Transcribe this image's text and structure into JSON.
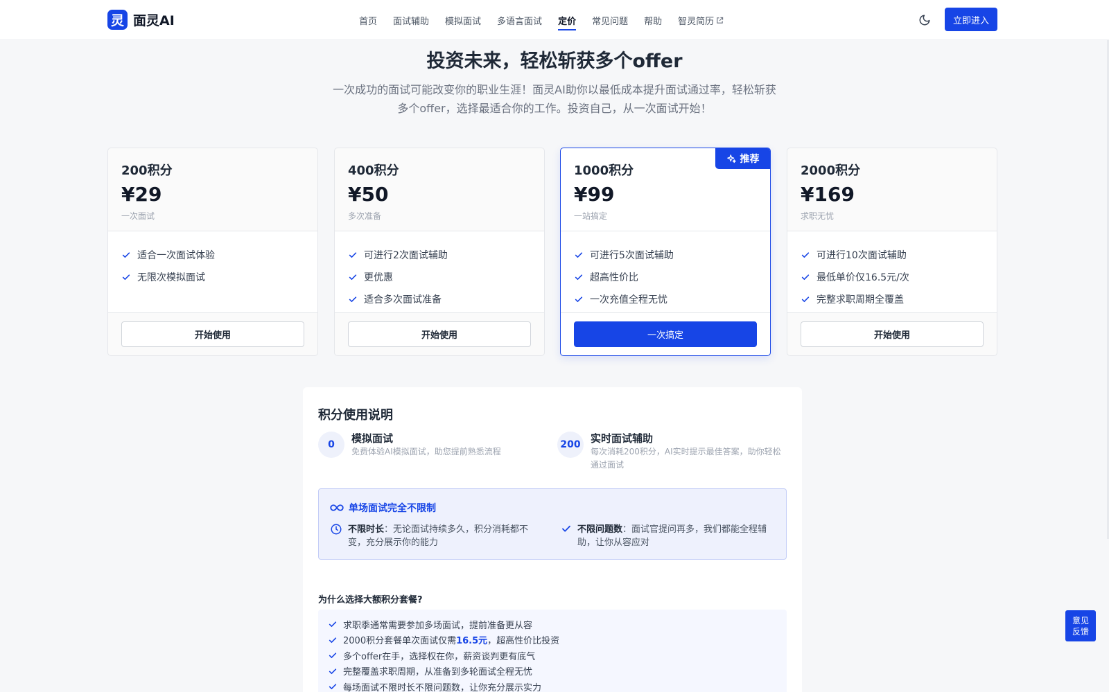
{
  "header": {
    "logo_mark": "灵",
    "logo_text": "面灵AI",
    "nav": [
      {
        "label": "首页"
      },
      {
        "label": "面试辅助"
      },
      {
        "label": "模拟面试"
      },
      {
        "label": "多语言面试"
      },
      {
        "label": "定价",
        "active": true
      },
      {
        "label": "常见问题"
      },
      {
        "label": "帮助"
      },
      {
        "label": "智灵简历",
        "external": true
      }
    ],
    "enter_label": "立即进入"
  },
  "hero": {
    "title": "投资未来，轻松斩获多个offer",
    "subtitle": "一次成功的面试可能改变你的职业生涯！面灵AI助你以最低成本提升面试通过率，轻松斩获多个offer，选择最适合你的工作。投资自己，从一次面试开始！"
  },
  "plans": [
    {
      "name": "200积分",
      "price": "¥29",
      "tag": "一次面试",
      "features": [
        "适合一次面试体验",
        "无限次模拟面试"
      ],
      "button": "开始使用"
    },
    {
      "name": "400积分",
      "price": "¥50",
      "tag": "多次准备",
      "features": [
        "可进行2次面试辅助",
        "更优惠",
        "适合多次面试准备"
      ],
      "button": "开始使用"
    },
    {
      "name": "1000积分",
      "price": "¥99",
      "tag": "一站搞定",
      "features": [
        "可进行5次面试辅助",
        "超高性价比",
        "一次充值全程无忧"
      ],
      "button": "一次搞定",
      "badge": "推荐",
      "recommended": true
    },
    {
      "name": "2000积分",
      "price": "¥169",
      "tag": "求职无忧",
      "features": [
        "可进行10次面试辅助",
        "最低单价仅16.5元/次",
        "完整求职周期全覆盖"
      ],
      "button": "开始使用"
    }
  ],
  "credits": {
    "title": "积分使用说明",
    "usage": [
      {
        "num": "0",
        "title": "模拟面试",
        "desc": "免费体验AI模拟面试，助您提前熟悉流程"
      },
      {
        "num": "200",
        "title": "实时面试辅助",
        "desc": "每次消耗200积分，AI实时提示最佳答案，助你轻松通过面试"
      }
    ],
    "unlimited": {
      "title": "单场面试完全不限制",
      "items": [
        {
          "label": "不限时长",
          "text": "：无论面试持续多久，积分消耗都不变，充分展示你的能力"
        },
        {
          "label": "不限问题数",
          "text": "：面试官提问再多，我们都能全程辅助，让你从容应对"
        }
      ]
    },
    "why_title": "为什么选择大额积分套餐?",
    "why": {
      "i0": "求职季通常需要参加多场面试，提前准备更从容",
      "i1_pre": "2000积分套餐单次面试仅需",
      "i1_hl": "16.5元",
      "i1_post": "，超高性价比投资",
      "i2": "多个offer在手，选择权在你，薪资谈判更有底气",
      "i3": "完整覆盖求职周期，从准备到多轮面试全程无忧",
      "i4": "每场面试不限时长不限问题数，让你充分展示实力"
    }
  },
  "feedback": "意见反馈",
  "colors": {
    "accent": "#1745e6",
    "bg": "#f6f7f9"
  }
}
